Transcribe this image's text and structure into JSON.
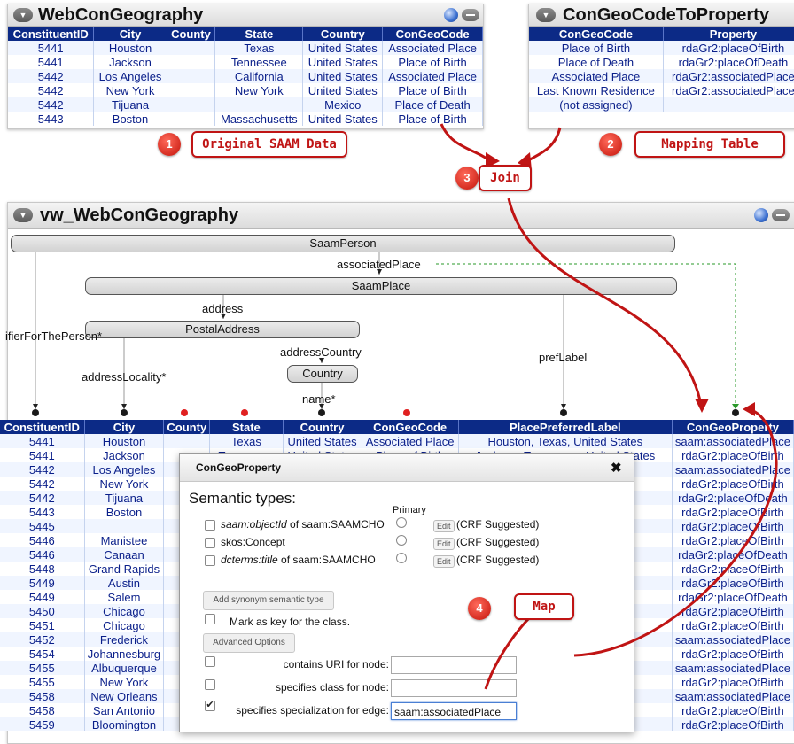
{
  "panel1": {
    "title": "WebConGeography",
    "headers": [
      "ConstituentID",
      "City",
      "County",
      "State",
      "Country",
      "ConGeoCode"
    ],
    "rows": [
      [
        "5441",
        "Houston",
        "",
        "Texas",
        "United States",
        "Associated Place"
      ],
      [
        "5441",
        "Jackson",
        "",
        "Tennessee",
        "United States",
        "Place of Birth"
      ],
      [
        "5442",
        "Los Angeles",
        "",
        "California",
        "United States",
        "Associated Place"
      ],
      [
        "5442",
        "New York",
        "",
        "New York",
        "United States",
        "Place of Birth"
      ],
      [
        "5442",
        "Tijuana",
        "",
        "",
        "Mexico",
        "Place of Death"
      ],
      [
        "5443",
        "Boston",
        "",
        "Massachusetts",
        "United States",
        "Place of Birth"
      ]
    ]
  },
  "panel2": {
    "title": "ConGeoCodeToProperty",
    "headers": [
      "ConGeoCode",
      "Property"
    ],
    "rows": [
      [
        "Place of Birth",
        "rdaGr2:placeOfBirth"
      ],
      [
        "Place of Death",
        "rdaGr2:placeOfDeath"
      ],
      [
        "Associated Place",
        "rdaGr2:associatedPlace"
      ],
      [
        "Last Known Residence",
        "rdaGr2:associatedPlace"
      ],
      [
        "(not assigned)",
        ""
      ]
    ]
  },
  "callouts": {
    "c1": {
      "num": "1",
      "label": "Original SAAM Data"
    },
    "c2": {
      "num": "2",
      "label": "Mapping Table"
    },
    "c3": {
      "num": "3",
      "label": "Join"
    },
    "c4": {
      "num": "4",
      "label": "Map"
    }
  },
  "main": {
    "title": "vw_WebConGeography",
    "nodes": {
      "saamPerson": "SaamPerson",
      "saamPlace": "SaamPlace",
      "postalAddress": "PostalAddress",
      "country": "Country"
    },
    "edges": {
      "associatedPlace": "associatedPlace",
      "address": "address",
      "identifier": "ifierForThePerson*",
      "addressCountry": "addressCountry",
      "prefLabel": "prefLabel",
      "addressLocality": "addressLocality*",
      "name": "name*"
    },
    "headers": [
      "ConstituentID",
      "City",
      "County",
      "State",
      "Country",
      "ConGeoCode",
      "PlacePreferredLabel",
      "ConGeoProperty"
    ],
    "rows": [
      [
        "5441",
        "Houston",
        "",
        "Texas",
        "United States",
        "Associated Place",
        "Houston, Texas, United States",
        "saam:associatedPlace"
      ],
      [
        "5441",
        "Jackson",
        "",
        "Tennessee",
        "United States",
        "Place of Birth",
        "Jackson, Tennessee, United States",
        "rdaGr2:placeOfBirth"
      ],
      [
        "5442",
        "Los Angeles",
        "",
        "",
        "",
        "",
        "States",
        "saam:associatedPlace"
      ],
      [
        "5442",
        "New York",
        "",
        "",
        "",
        "",
        "tates",
        "rdaGr2:placeOfBirth"
      ],
      [
        "5442",
        "Tijuana",
        "",
        "",
        "",
        "",
        "",
        "rdaGr2:placeOfDeath"
      ],
      [
        "5443",
        "Boston",
        "",
        "",
        "",
        "",
        "States",
        "rdaGr2:placeOfBirth"
      ],
      [
        "5445",
        "",
        "",
        "",
        "",
        "",
        "",
        "rdaGr2:placeOfBirth"
      ],
      [
        "5446",
        "Manistee",
        "",
        "",
        "",
        "",
        "ates",
        "rdaGr2:placeOfBirth"
      ],
      [
        "5446",
        "Canaan",
        "",
        "",
        "",
        "",
        "tates",
        "rdaGr2:placeOfDeath"
      ],
      [
        "5448",
        "Grand Rapids",
        "",
        "",
        "",
        "",
        "States",
        "rdaGr2:placeOfBirth"
      ],
      [
        "5449",
        "Austin",
        "",
        "",
        "",
        "",
        "es",
        "rdaGr2:placeOfBirth"
      ],
      [
        "5449",
        "Salem",
        "",
        "",
        "",
        "",
        "es",
        "rdaGr2:placeOfDeath"
      ],
      [
        "5450",
        "Chicago",
        "",
        "",
        "",
        "",
        "es",
        "rdaGr2:placeOfBirth"
      ],
      [
        "5451",
        "Chicago",
        "",
        "",
        "",
        "",
        "es",
        "rdaGr2:placeOfBirth"
      ],
      [
        "5452",
        "Frederick",
        "",
        "",
        "",
        "",
        "tates",
        "saam:associatedPlace"
      ],
      [
        "5454",
        "Johannesburg",
        "",
        "",
        "",
        "",
        "ca",
        "rdaGr2:placeOfBirth"
      ],
      [
        "5455",
        "Albuquerque",
        "",
        "",
        "",
        "",
        "d States",
        "saam:associatedPlace"
      ],
      [
        "5455",
        "New York",
        "",
        "",
        "",
        "",
        "tates",
        "rdaGr2:placeOfBirth"
      ],
      [
        "5458",
        "New Orleans",
        "",
        "",
        "",
        "",
        "States",
        "saam:associatedPlace"
      ],
      [
        "5458",
        "San Antonio",
        "",
        "",
        "",
        "",
        "tates",
        "rdaGr2:placeOfBirth"
      ],
      [
        "5459",
        "Bloomington",
        "",
        "",
        "",
        "",
        "tates",
        "rdaGr2:placeOfBirth"
      ]
    ]
  },
  "dialog": {
    "title": "ConGeoProperty",
    "heading": "Semantic types:",
    "primary_label": "Primary",
    "types": [
      {
        "prop": "saam:objectId",
        "of": " of saam:SAAMCHO",
        "edit": "Edit",
        "note": "(CRF Suggested)"
      },
      {
        "prop": "skos:Concept",
        "of": "",
        "edit": "Edit",
        "note": "(CRF Suggested)"
      },
      {
        "prop": "dcterms:title",
        "of": " of saam:SAAMCHO",
        "edit": "Edit",
        "note": "(CRF Suggested)"
      }
    ],
    "add_synonym": "Add synonym semantic type",
    "mark_key": "Mark as key for the class.",
    "advanced": "Advanced Options",
    "uri_label": "contains URI for node:",
    "class_label": "specifies class for node:",
    "edge_label": "specifies specialization for edge:",
    "edge_value": "saam:associatedPlace"
  }
}
